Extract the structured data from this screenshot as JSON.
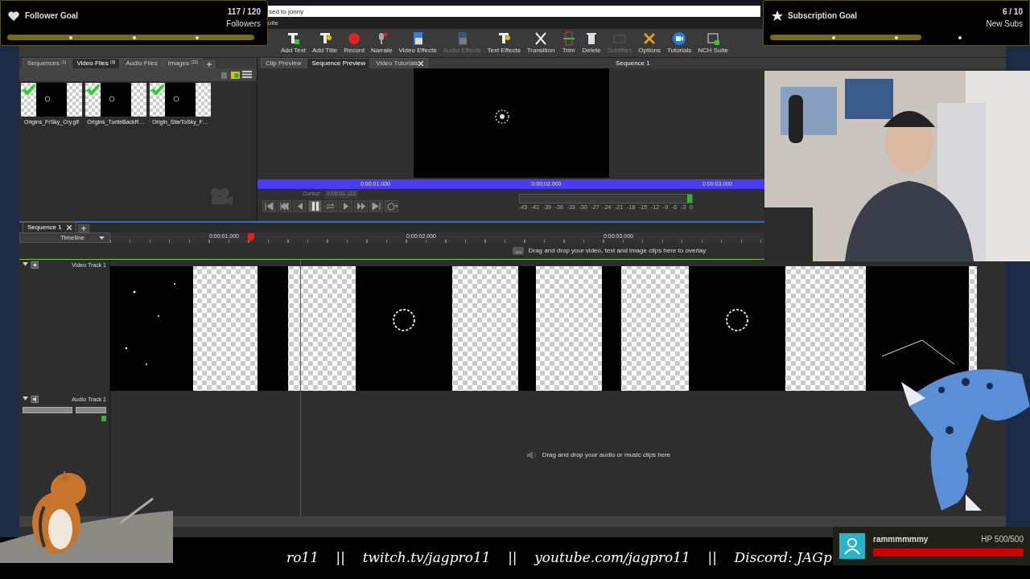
{
  "follower_goal": {
    "title": "Follower Goal",
    "count": "117 / 120",
    "unit": "Followers",
    "level": 0.975
  },
  "subscription_goal": {
    "title": "Subscription Goal",
    "count": "6 / 10",
    "unit": "New Subs",
    "level": 0.6
  },
  "browser_bar": {
    "text": "sed to jonny"
  },
  "menu": [
    "uite"
  ],
  "toolbar": [
    {
      "label": "Add Text",
      "kind": "text",
      "disabled": false
    },
    {
      "label": "Add Title",
      "kind": "title",
      "disabled": false
    },
    {
      "label": "Record",
      "kind": "record",
      "disabled": false
    },
    {
      "label": "Narrate",
      "kind": "mic",
      "disabled": false
    },
    {
      "label": "Video Effects",
      "kind": "fx",
      "disabled": false
    },
    {
      "label": "Audio Effects",
      "kind": "fx",
      "disabled": true
    },
    {
      "label": "Text Effects",
      "kind": "title",
      "disabled": false
    },
    {
      "label": "Transition",
      "kind": "transition",
      "disabled": false
    },
    {
      "label": "Trim",
      "kind": "trim",
      "disabled": false
    },
    {
      "label": "Delete",
      "kind": "delete",
      "disabled": false
    },
    {
      "label": "Subtitles",
      "kind": "sub",
      "disabled": true
    },
    {
      "label": "Options",
      "kind": "tools",
      "disabled": false
    },
    {
      "label": "Tutorials",
      "kind": "camera",
      "disabled": false
    },
    {
      "label": "NCH Suite",
      "kind": "suite",
      "disabled": false
    }
  ],
  "media_tabs": [
    {
      "label": "Sequences",
      "count": "(1)",
      "selected": false
    },
    {
      "label": "Video Files",
      "count": "(3)",
      "selected": true
    },
    {
      "label": "Audio Files",
      "selected": false
    },
    {
      "label": "Images",
      "count": "(22)",
      "selected": false
    }
  ],
  "clips": [
    {
      "name": "Origins_FrSky_Cry.gif",
      "checked": true
    },
    {
      "name": "Origins_TurtleBackR…",
      "checked": true
    },
    {
      "name": "Origin_StarToSky_F…",
      "checked": true
    }
  ],
  "preview_tabs": [
    {
      "label": "Clip Preview",
      "selected": false,
      "closable": false
    },
    {
      "label": "Sequence Preview",
      "selected": true,
      "closable": false
    },
    {
      "label": "Video Tutorials",
      "selected": false,
      "closable": true
    }
  ],
  "preview_title": "Sequence 1",
  "scrubber": {
    "ticks": [
      "0:00:01.000",
      "0:00:02.000",
      "0:00:03.000"
    ],
    "cursor_label": "Cursor:",
    "cursor_value": "0:00:01.115"
  },
  "meter_labels": [
    "-45",
    "-42",
    "-39",
    "-36",
    "-33",
    "-30",
    "-27",
    "-24",
    "-21",
    "-18",
    "-15",
    "-12",
    "-9",
    "-6",
    "-3",
    "0"
  ],
  "sequence_tabs": [
    {
      "label": "Sequence 1",
      "selected": true
    }
  ],
  "timeline": {
    "label": "Timeline",
    "ticks": [
      "0:00:01.000",
      "0:00:02.000",
      "0:00:03.000"
    ],
    "overlay_hint": "Drag and drop your video, text and image clips here to overlay"
  },
  "video_track": {
    "name": "Video Track 1"
  },
  "audio_track": {
    "name": "Audio Track 1",
    "hint": "Drag and drop your audio or music clips here"
  },
  "ticker": {
    "text": "ro11    ||    twitch.tv/jagpro11    ||    youtube.com/jagpro11    ||    Discord: JAGp"
  },
  "viewer": {
    "name": "rammmmmmy",
    "hp": "HP 500/500",
    "level": 1
  }
}
